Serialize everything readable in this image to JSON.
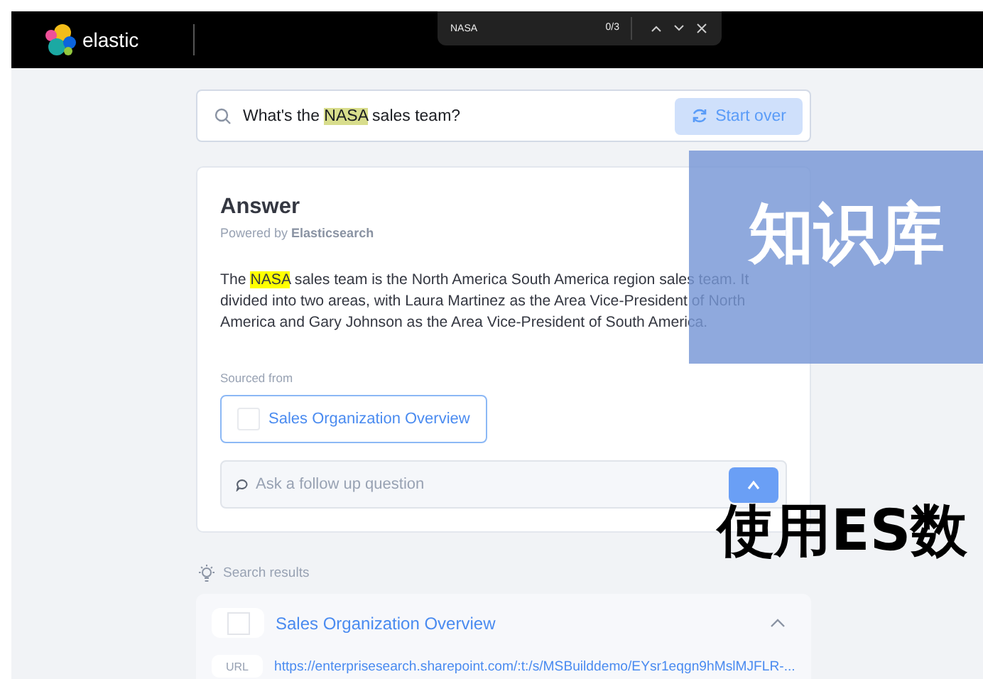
{
  "header": {
    "logo_text": "elastic"
  },
  "find_bar": {
    "value": "NASA",
    "count": "0/3"
  },
  "search": {
    "query": [
      {
        "text": "What's the ",
        "highlighted": false
      },
      {
        "text": "NASA",
        "highlighted": true
      },
      {
        "text": " sales team?",
        "highlighted": false
      }
    ],
    "start_over": "Start over"
  },
  "answer": {
    "title": "Answer",
    "powered_by": "Powered by **Elasticsearch**",
    "paragraph": [
      {
        "text": "The ",
        "highlighted": false
      },
      {
        "text": "NASA",
        "highlighted": true
      },
      {
        "text": " sales team is the North America South America region sales team. It divided into two areas, with Laura Martinez as the Area Vice-President of North America and Gary Johnson as the Area Vice-President of South America.",
        "highlighted": false
      }
    ],
    "sourced_label": "Sourced from",
    "sources": [
      "Sales Organization Overview"
    ],
    "followup_placeholder": "Ask a follow up question"
  },
  "search_results": {
    "label": "Search results",
    "results": [
      {
        "title": "Sales Organization Overview",
        "expanded": true,
        "url_label": "URL",
        "url": "https://enterprisesearch.sharepoint.com/:t:/s/MSBuilddemo/EYsr1eqgn9hMslMJFLR-..."
      }
    ]
  },
  "overlay": {
    "banner": "知识库",
    "caption": "使用ES数"
  }
}
